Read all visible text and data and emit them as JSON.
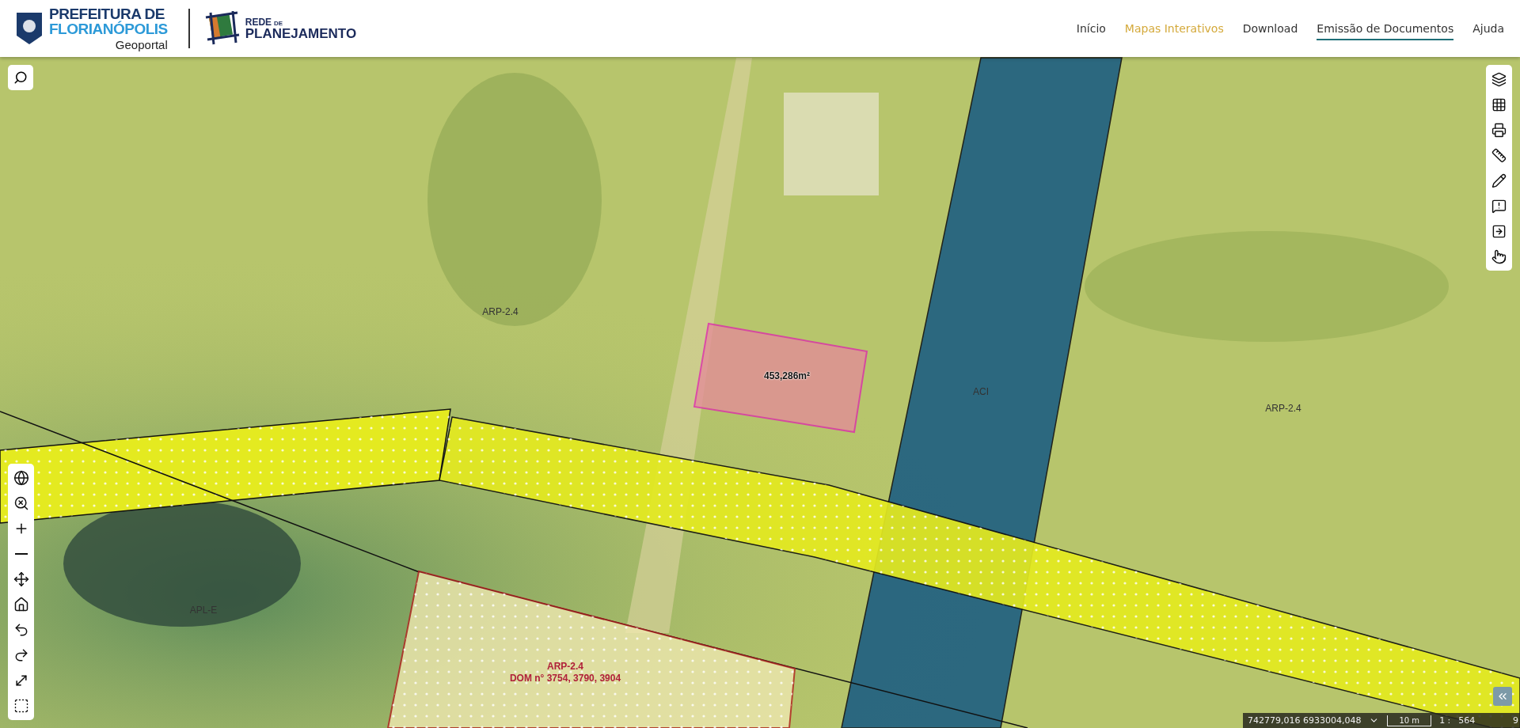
{
  "header": {
    "brand": {
      "line_1": "PREFEITURA DE",
      "line_2": "FLORIANÓPOLIS",
      "subtitle": "Geoportal"
    },
    "partner": {
      "small": "DE",
      "line_1": "REDE",
      "line_2": "PLANEJAMENTO"
    },
    "nav": [
      {
        "label": "Início",
        "selected": false,
        "underlined": false
      },
      {
        "label": "Mapas Interativos",
        "selected": true,
        "underlined": false
      },
      {
        "label": "Download",
        "selected": false,
        "underlined": false
      },
      {
        "label": "Emissão de Documentos",
        "selected": false,
        "underlined": true
      },
      {
        "label": "Ajuda",
        "selected": false,
        "underlined": false
      }
    ]
  },
  "map": {
    "labels": [
      {
        "kind": "zone",
        "text": "ARP-2.4"
      },
      {
        "kind": "area",
        "text": "453,286m²"
      },
      {
        "kind": "zone",
        "text": "ACI"
      },
      {
        "kind": "zone",
        "text": "ARP-2.4"
      },
      {
        "kind": "zone",
        "text": "APL-E"
      },
      {
        "kind": "lot",
        "text": "ARP-2.4"
      },
      {
        "kind": "lot",
        "text": "DOM n° 3754, 3790, 3904"
      }
    ]
  },
  "status_bar": {
    "coordinates": "742779,016 6933004,048",
    "scale_bar": "10 m",
    "scale_prefix": "1 :",
    "scale": "564",
    "extra": "9"
  }
}
